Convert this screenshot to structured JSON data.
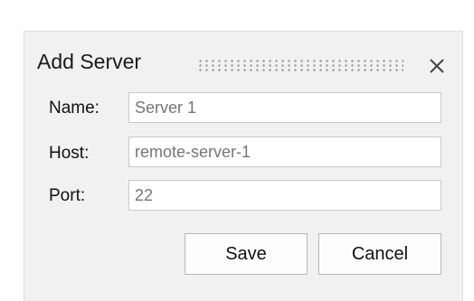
{
  "dialog": {
    "title": "Add Server",
    "close_icon": "close-icon"
  },
  "form": {
    "name": {
      "label": "Name:",
      "placeholder": "Server 1",
      "value": ""
    },
    "host": {
      "label": "Host:",
      "placeholder": "remote-server-1",
      "value": ""
    },
    "port": {
      "label": "Port:",
      "placeholder": "22",
      "value": ""
    }
  },
  "buttons": {
    "save_label": "Save",
    "cancel_label": "Cancel"
  },
  "colors": {
    "dialog_bg": "#f1f1f1",
    "field_border": "#c9c9c9",
    "placeholder_text": "#8c8c8c"
  }
}
